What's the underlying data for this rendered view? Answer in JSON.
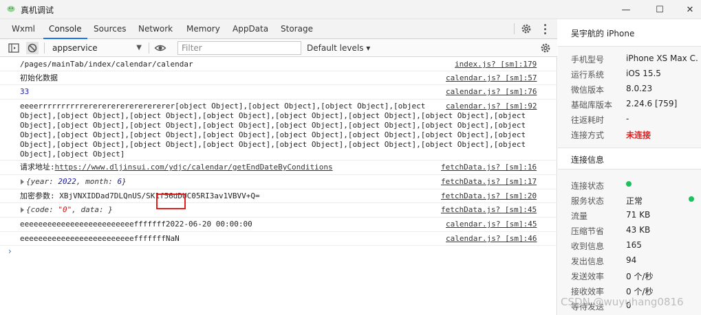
{
  "window": {
    "title": "真机调试",
    "minimize_glyph": "—",
    "maximize_glyph": "☐",
    "close_glyph": "✕"
  },
  "tabs": [
    "Wxml",
    "Console",
    "Sources",
    "Network",
    "Memory",
    "AppData",
    "Storage"
  ],
  "active_tab": "Console",
  "toolbar": {
    "context": "appservice",
    "filter_placeholder": "Filter",
    "levels": "Default levels ▾"
  },
  "console": {
    "rows": [
      {
        "text": "/pages/mainTab/index/calendar/calendar",
        "source": "index.js? [sm]:179"
      },
      {
        "text": "初始化数据",
        "source": "calendar.js? [sm]:57"
      },
      {
        "text": "33",
        "source": "calendar.js? [sm]:76"
      },
      {
        "lines": [
          "eeeerrrrrrrrrrerererererererererer[object Object],[object Object],[object Object],[object",
          "Object],[object Object],[object Object],[object Object],[object Object],[object Object],[object Object],[object",
          "Object],[object Object],[object Object],[object Object],[object Object],[object Object],[object Object],[object",
          "Object],[object Object],[object Object],[object Object],[object Object],[object Object],[object Object],[object",
          "Object],[object Object],[object Object],[object Object],[object Object],[object Object],[object Object],[object",
          "Object],[object Object]"
        ],
        "source": "calendar.js? [sm]:92"
      },
      {
        "label": "请求地址:",
        "url": "https://www.dljinsui.com/ydjc/calendar/getEndDateByConditions",
        "source": "fetchData.js? [sm]:16"
      },
      {
        "obj": {
          "prefix": "{year: ",
          "year": "2022",
          "mid": ", month: ",
          "month": "6",
          "suffix": "}"
        },
        "source": "fetchData.js? [sm]:17"
      },
      {
        "text": "加密参数: XBjVNXIDDad7DLQnUS/SK1f56dDUC05RI3av1VBVV+Q=",
        "source": "fetchData.js? [sm]:20"
      },
      {
        "obj2": {
          "prefix": "{code: ",
          "code": "\"0\"",
          "suffix": ", data: }"
        },
        "source": "fetchData.js? [sm]:45"
      },
      {
        "text": "eeeeeeeeeeeeeeeeeeeeeeeeefffffff2022-06-20 00:00:00",
        "source": "calendar.js? [sm]:45"
      },
      {
        "text": "eeeeeeeeeeeeeeeeeeeeeeeeefffffffNaN",
        "source": "calendar.js? [sm]:46"
      }
    ],
    "prompt": "›"
  },
  "right_panel": {
    "device_name": "吴宇航的 iPhone",
    "device_info": [
      {
        "label": "手机型号",
        "value": "iPhone XS Max C..."
      },
      {
        "label": "运行系统",
        "value": "iOS 15.5"
      },
      {
        "label": "微信版本",
        "value": "8.0.23"
      },
      {
        "label": "基础库版本",
        "value": "2.24.6 [759]"
      },
      {
        "label": "往返耗时",
        "value": "-"
      },
      {
        "label": "连接方式",
        "value": "未连接"
      }
    ],
    "connection_title": "连接信息",
    "connection_info": [
      {
        "label": "连接状态",
        "value": ""
      },
      {
        "label": "服务状态",
        "value": "正常"
      },
      {
        "label": "流量",
        "value": "71 KB"
      },
      {
        "label": "压缩节省",
        "value": "43 KB"
      },
      {
        "label": "收到信息",
        "value": "165"
      },
      {
        "label": "发出信息",
        "value": "94"
      },
      {
        "label": "发送效率",
        "value": "0 个/秒"
      },
      {
        "label": "接收效率",
        "value": "0 个/秒"
      },
      {
        "label": "等待发送",
        "value": "0"
      }
    ],
    "status_color": "#1bc25b",
    "disconnected_color": "#e21d1d"
  },
  "watermark": "CSDN @wuyuhang0816"
}
